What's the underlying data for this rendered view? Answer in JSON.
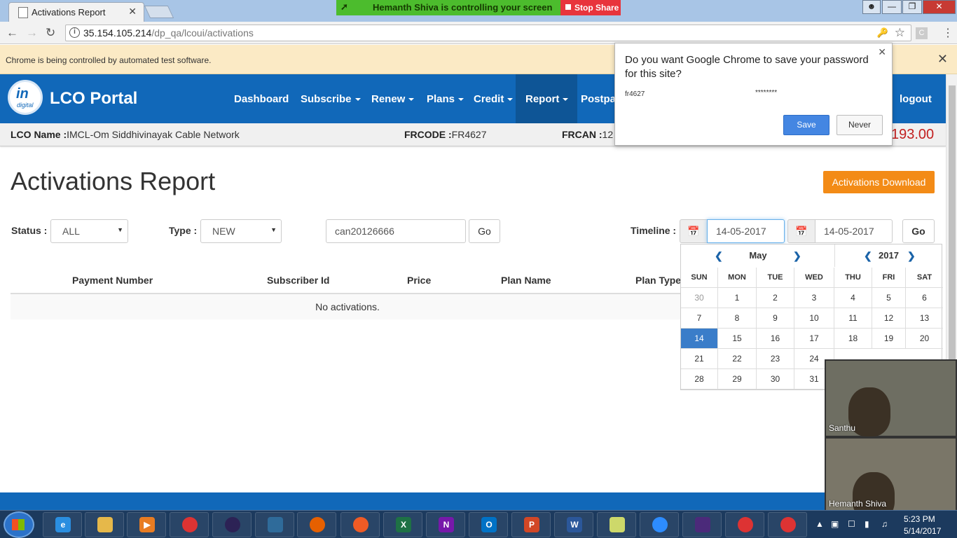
{
  "browser": {
    "tab_title": "Activations Report",
    "tab_close": "✕",
    "screen_share_text": "Hemanth Shiva is controlling your screen",
    "stop_share_label": "Stop Share",
    "url_host": "35.154.105.214",
    "url_path": "/dp_qa/lcoui/activations",
    "infobar_text": "Chrome is being controlled by automated test software.",
    "infobar_close": "✕"
  },
  "password_bubble": {
    "question": "Do you want Google Chrome to save your password for this site?",
    "username": "fr4627",
    "password": "********",
    "save_label": "Save",
    "never_label": "Never",
    "close": "✕"
  },
  "portal": {
    "brand": "LCO Portal",
    "logo_top": "in",
    "logo_bottom": "digital",
    "nav": [
      {
        "label": "Dashboard"
      },
      {
        "label": "Subscribe"
      },
      {
        "label": "Renew"
      },
      {
        "label": "Plans"
      },
      {
        "label": "Credit"
      },
      {
        "label": "Report"
      },
      {
        "label": "Postpa"
      },
      {
        "label": "logout"
      }
    ],
    "lco_name_label": "LCO Name :",
    "lco_name_value": "IMCL-Om Siddhivinayak Cable Network",
    "frcode_label": "FRCODE :",
    "frcode_value": "FR4627",
    "frcan_label": "FRCAN :",
    "frcan_value": "12",
    "balance": "193.00"
  },
  "page": {
    "title": "Activations Report",
    "download_label": "Activations Download",
    "status_label": "Status :",
    "status_value": "ALL",
    "type_label": "Type :",
    "type_value": "NEW",
    "search_value": "can20126666",
    "go_label": "Go",
    "timeline_label": "Timeline :",
    "date_from": "14-05-2017",
    "date_to": "14-05-2017",
    "timeline_go": "Go",
    "columns": [
      "Payment Number",
      "Subscriber Id",
      "Price",
      "Plan Name",
      "Plan Type"
    ],
    "empty_text": "No activations."
  },
  "datepicker": {
    "month": "May",
    "year": "2017",
    "days_of_week": [
      "SUN",
      "MON",
      "TUE",
      "WED",
      "THU",
      "FRI",
      "SAT"
    ],
    "weeks": [
      [
        "30",
        "1",
        "2",
        "3",
        "4",
        "5",
        "6"
      ],
      [
        "7",
        "8",
        "9",
        "10",
        "11",
        "12",
        "13"
      ],
      [
        "14",
        "15",
        "16",
        "17",
        "18",
        "19",
        "20"
      ],
      [
        "21",
        "22",
        "23",
        "24",
        "",
        "",
        ""
      ],
      [
        "28",
        "29",
        "30",
        "31",
        "",
        "",
        ""
      ]
    ],
    "selected_day": "14"
  },
  "video": {
    "top_name": "Santhu",
    "bottom_name": "Hemanth Shiva"
  },
  "taskbar": {
    "time": "5:23 PM",
    "date": "5/14/2017"
  }
}
